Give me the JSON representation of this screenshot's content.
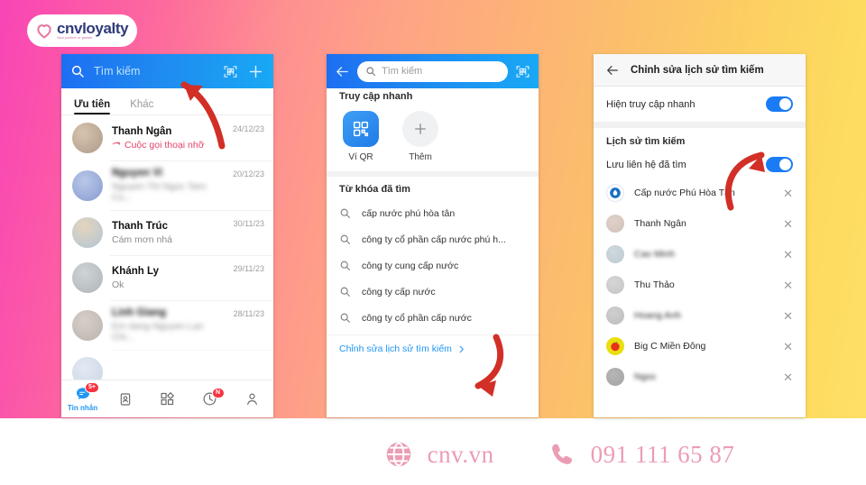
{
  "brand": {
    "logo_text": "cnvloyalty",
    "logo_tagline": "Your partner in growth",
    "heart_icon": "heart-icon"
  },
  "phone1": {
    "header": {
      "search_placeholder": "Tìm kiếm",
      "search_icon": "search-icon",
      "qr_icon": "qr-scan-icon",
      "plus_icon": "plus-icon"
    },
    "tabs": [
      {
        "label": "Ưu tiên",
        "active": true
      },
      {
        "label": "Khác",
        "active": false
      }
    ],
    "chats": [
      {
        "name": "Thanh Ngân",
        "sub": "Cuộc gọi thoại nhỡ",
        "date": "24/12/23",
        "missed": true,
        "blurred": false
      },
      {
        "name": "Nguyen Vi",
        "sub": "Nguyen Thi Ngoc Tam: Co...",
        "date": "20/12/23",
        "missed": false,
        "blurred": true
      },
      {
        "name": "Thanh Trúc",
        "sub": "Cám mơn nhá",
        "date": "30/11/23",
        "missed": false,
        "blurred": false
      },
      {
        "name": "Khánh Ly",
        "sub": "Ok",
        "date": "29/11/23",
        "missed": false,
        "blurred": false
      },
      {
        "name": "Linh Giang",
        "sub": "Em dang Nguyen Lan Chi...",
        "date": "28/11/23",
        "missed": false,
        "blurred": true
      }
    ],
    "nav": [
      {
        "label": "Tin nhắn",
        "icon": "message-icon",
        "badge": "5+",
        "active": true
      },
      {
        "label": "",
        "icon": "contacts-icon",
        "badge": "",
        "active": false
      },
      {
        "label": "",
        "icon": "grid-apps-icon",
        "badge": "",
        "active": false
      },
      {
        "label": "",
        "icon": "clock-icon",
        "badge": "N",
        "active": false
      },
      {
        "label": "",
        "icon": "person-icon",
        "badge": "",
        "active": false
      }
    ]
  },
  "phone2": {
    "header": {
      "back_icon": "back-arrow-icon",
      "search_placeholder": "Tìm kiếm",
      "search_icon": "search-icon",
      "qr_icon": "qr-scan-icon"
    },
    "quick_access_title": "Truy cập nhanh",
    "quick_items": [
      {
        "label": "Ví QR",
        "icon": "qr-wallet-icon"
      },
      {
        "label": "Thêm",
        "icon": "plus-icon"
      }
    ],
    "keywords_title": "Từ khóa đã tìm",
    "keywords": [
      "cấp nước phú hòa tân",
      "công ty cổ phần cấp nước phú h...",
      "công ty cung cấp nước",
      "công ty cấp nước",
      "công ty cổ phần cấp nước"
    ],
    "edit_link": "Chỉnh sửa lịch sử tìm kiếm",
    "edit_chevron": "chevron-right-icon"
  },
  "phone3": {
    "header": {
      "back_icon": "back-arrow-icon",
      "title": "Chỉnh sửa lịch sử tìm kiếm"
    },
    "settings": [
      {
        "label": "Hiện truy cập nhanh",
        "on": true
      }
    ],
    "history_title": "Lịch sử tìm kiếm",
    "save_contacts": {
      "label": "Lưu liên hệ đã tìm",
      "on": true
    },
    "history": [
      {
        "name": "Cấp nước Phú Hòa Tân",
        "blurred": false,
        "avatar": "water-company-logo"
      },
      {
        "name": "Thanh Ngân",
        "blurred": false,
        "avatar": "contact-avatar"
      },
      {
        "name": "Cao Minh",
        "blurred": true,
        "avatar": "contact-avatar"
      },
      {
        "name": "Thu Thảo",
        "blurred": false,
        "avatar": "contact-avatar"
      },
      {
        "name": "Hoang Anh",
        "blurred": true,
        "avatar": "contact-avatar"
      },
      {
        "name": "Big C Miền Đông",
        "blurred": false,
        "avatar": "bigc-logo"
      },
      {
        "name": "Ngoc",
        "blurred": true,
        "avatar": "contact-avatar"
      }
    ],
    "remove_icon": "close-x-icon"
  },
  "footer": {
    "website": "cnv.vn",
    "website_icon": "globe-icon",
    "phone": "091 111 65 87",
    "phone_icon": "phone-icon"
  },
  "colors": {
    "zalo_blue": "#1f8af0",
    "toggle_on": "#1a7cf5",
    "arrow_red": "#d22f27",
    "brand_pink": "#eb9db4",
    "badge_red": "#f5333f"
  }
}
